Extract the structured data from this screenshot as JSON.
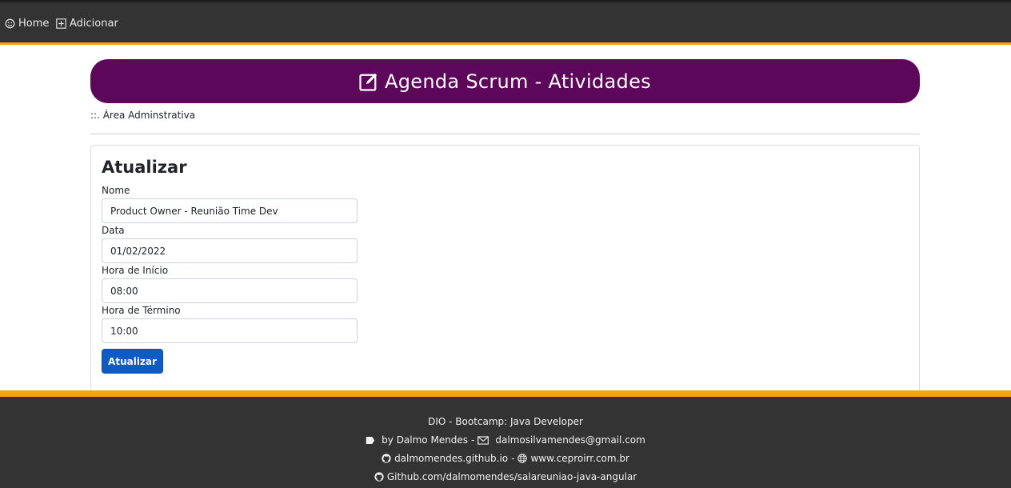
{
  "nav": {
    "home_label": "Home",
    "add_label": "Adicionar"
  },
  "header": {
    "title": "Agenda Scrum - Atividades",
    "subtitle": "::. Área Adminstrativa"
  },
  "form": {
    "title": "Atualizar",
    "fields": [
      {
        "label": "Nome",
        "value": "Product Owner - Reunião Time Dev"
      },
      {
        "label": "Data",
        "value": "01/02/2022"
      },
      {
        "label": "Hora de Início",
        "value": "08:00"
      },
      {
        "label": "Hora de Término",
        "value": "10:00"
      }
    ],
    "submit_label": "Atualizar"
  },
  "footer": {
    "line1": "DIO - Bootcamp: Java Developer",
    "author": "by Dalmo Mendes",
    "email": "dalmosilvamendes@gmail.com",
    "github_io": "dalmomendes.github.io",
    "website": "www.ceproirr.com.br",
    "repo": "Github.com/dalmomendes/salareuniao-java-angular"
  },
  "colors": {
    "navbar_bg": "#333333",
    "accent_orange": "#f5a20f",
    "banner_purple": "#5c0759",
    "button_blue": "#0d5bc6"
  }
}
